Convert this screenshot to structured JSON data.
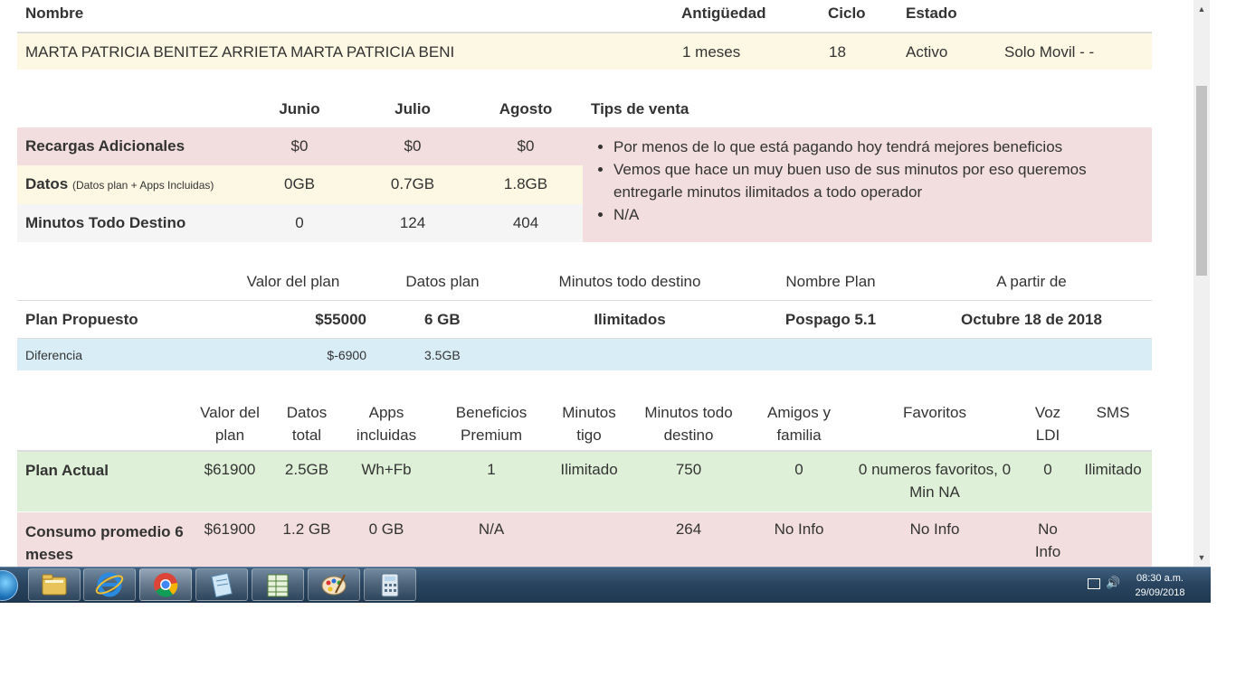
{
  "customer": {
    "headers": {
      "name": "Nombre",
      "antiguedad": "Antigüedad",
      "ciclo": "Ciclo",
      "estado": "Estado"
    },
    "name": "MARTA PATRICIA BENITEZ ARRIETA MARTA PATRICIA BENI",
    "antiguedad": "1 meses",
    "ciclo": "18",
    "estado": "Activo",
    "extra": "Solo Movil - -"
  },
  "consumption": {
    "months": [
      "Junio",
      "Julio",
      "Agosto"
    ],
    "tips_header": "Tips de venta",
    "rows": [
      {
        "label": "Recargas Adicionales",
        "note": "",
        "values": [
          "$0",
          "$0",
          "$0"
        ]
      },
      {
        "label": "Datos",
        "note": "(Datos plan + Apps Incluidas)",
        "values": [
          "0GB",
          "0.7GB",
          "1.8GB"
        ]
      },
      {
        "label": "Minutos Todo Destino",
        "note": "",
        "values": [
          "0",
          "124",
          "404"
        ]
      }
    ],
    "tips": [
      "Por menos de lo que está pagando hoy tendrá mejores beneficios",
      "Vemos que hace un muy buen uso de sus minutos por eso queremos entregarle minutos ilimitados a todo operador",
      "N/A"
    ]
  },
  "proposed": {
    "headers": {
      "valor": "Valor del plan",
      "datos": "Datos plan",
      "minutos": "Minutos todo destino",
      "nombre": "Nombre Plan",
      "desde": "A partir de"
    },
    "label": "Plan Propuesto",
    "valor": "$55000",
    "datos": "6 GB",
    "minutos": "Ilimitados",
    "nombre": "Pospago 5.1",
    "desde": "Octubre 18 de 2018",
    "diff_label": "Diferencia",
    "diff_valor": "$-6900",
    "diff_datos": "3.5GB"
  },
  "current": {
    "headers": [
      [
        "Valor del",
        "plan"
      ],
      [
        "Datos",
        "total"
      ],
      [
        "Apps",
        "incluidas"
      ],
      [
        "Beneficios",
        "Premium"
      ],
      [
        "Minutos",
        "tigo"
      ],
      [
        "Minutos todo",
        "destino"
      ],
      [
        "Amigos y",
        "familia"
      ],
      [
        "Favoritos",
        ""
      ],
      [
        "Voz",
        "LDI"
      ],
      [
        "SMS",
        ""
      ]
    ],
    "actual": {
      "label": "Plan Actual",
      "values": [
        "$61900",
        "2.5GB",
        "Wh+Fb",
        "1",
        "Ilimitado",
        "750",
        "0",
        "0 numeros favoritos, 0 Min NA",
        "0",
        "Ilimitado"
      ]
    },
    "avg": {
      "label": "Consumo promedio 6 meses",
      "values": [
        "$61900",
        "1.2 GB",
        "0 GB",
        "N/A",
        "",
        "264",
        "No Info",
        "No Info",
        "No Info",
        ""
      ]
    }
  },
  "taskbar": {
    "time": "08:30 a.m.",
    "date": "29/09/2018",
    "apps": [
      "start-orb",
      "file-explorer",
      "internet-explorer",
      "chrome",
      "notepad",
      "spreadsheet",
      "paint",
      "calculator"
    ]
  },
  "colors": {
    "yellow": "#fcf8e3",
    "red": "#f2dede",
    "gray": "#f5f5f5",
    "blue": "#d9edf7",
    "green": "#dff0d8",
    "border": "#dddddd"
  }
}
